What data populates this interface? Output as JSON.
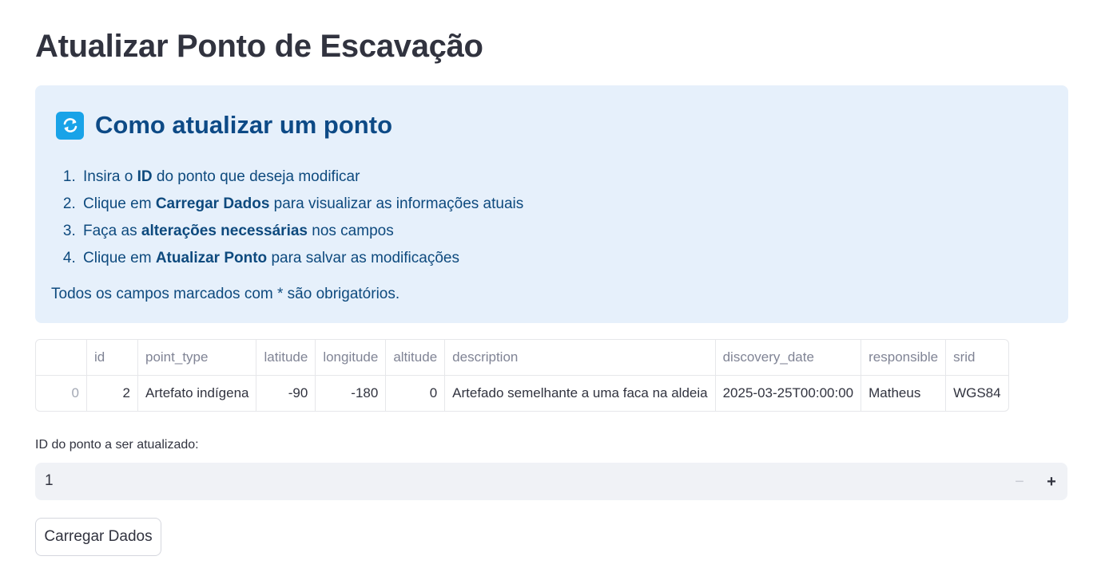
{
  "page_title": "Atualizar Ponto de Escavação",
  "info": {
    "icon": "refresh-icon",
    "title": "Como atualizar um ponto",
    "steps": [
      {
        "pre": "Insira o ",
        "bold": "ID",
        "post": " do ponto que deseja modificar"
      },
      {
        "pre": "Clique em ",
        "bold": "Carregar Dados",
        "post": " para visualizar as informações atuais"
      },
      {
        "pre": "Faça as ",
        "bold": "alterações necessárias",
        "post": " nos campos"
      },
      {
        "pre": "Clique em ",
        "bold": "Atualizar Ponto",
        "post": " para salvar as modificações"
      }
    ],
    "footnote": "Todos os campos marcados com * são obrigatórios."
  },
  "table": {
    "columns": [
      "",
      "id",
      "point_type",
      "latitude",
      "longitude",
      "altitude",
      "description",
      "discovery_date",
      "responsible",
      "srid"
    ],
    "rows": [
      [
        "0",
        "2",
        "Artefato indígena",
        "-90",
        "-180",
        "0",
        "Artefado semelhante a uma faca na aldeia",
        "2025-03-25T00:00:00",
        "Matheus",
        "WGS84"
      ]
    ]
  },
  "id_input": {
    "label": "ID do ponto a ser atualizado:",
    "value": "1",
    "minus": "−",
    "plus": "+"
  },
  "load_button": "Carregar Dados",
  "colors": {
    "info_bg": "#e6f0fb",
    "info_text": "#0e4a7e",
    "icon_bg": "#19a3e8"
  }
}
